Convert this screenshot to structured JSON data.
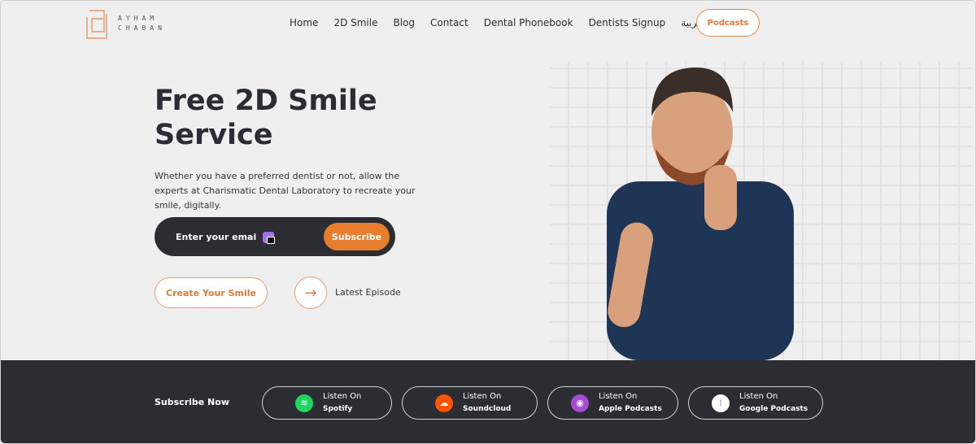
{
  "brand": {
    "line1": "AYHAM",
    "line2": "CHABAN",
    "accent": "#e67e2e"
  },
  "nav": {
    "items": [
      "Home",
      "2D Smile",
      "Blog",
      "Contact",
      "Dental Phonebook",
      "Dentists Signup",
      "العربية"
    ],
    "podcasts": "Podcasts"
  },
  "hero": {
    "title": "Free 2D Smile Service",
    "description": "Whether you have a preferred dentist or not, allow the experts at Charismatic Dental Laboratory to recreate your smile, digitally.",
    "email_placeholder": "Enter your email",
    "subscribe": "Subscribe",
    "create": "Create Your Smile",
    "latest": "Latest Episode"
  },
  "footer": {
    "subscribe_now": "Subscribe Now",
    "platforms": [
      {
        "pre": "Listen On",
        "name": "Spotify",
        "icon": "spotify-icon",
        "color": "#1ed760"
      },
      {
        "pre": "Listen On",
        "name": "Soundcloud",
        "icon": "soundcloud-icon",
        "color": "#ff5500"
      },
      {
        "pre": "Listen On",
        "name": "Apple Podcasts",
        "icon": "apple-podcasts-icon",
        "color": "#a64bd6"
      },
      {
        "pre": "Listen On",
        "name": "Google Podcasts",
        "icon": "google-podcasts-icon",
        "color": "#ffffff"
      }
    ]
  }
}
